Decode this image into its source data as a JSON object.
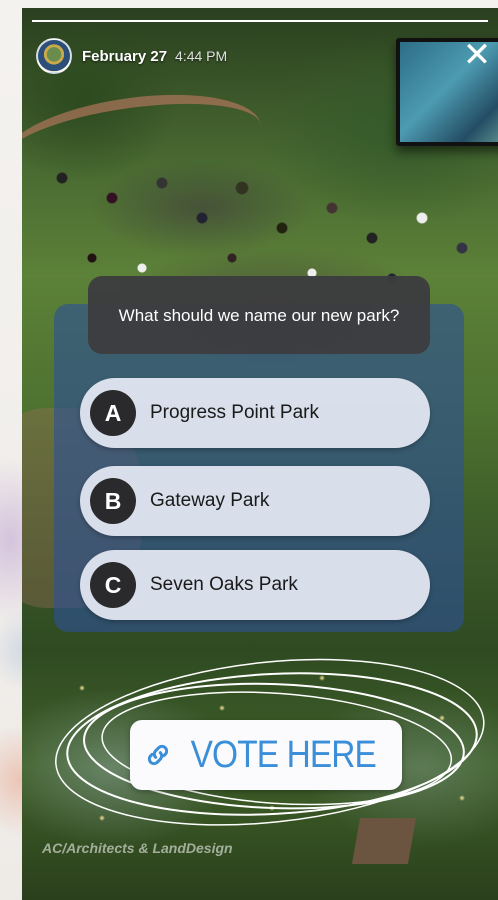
{
  "story": {
    "date": "February 27",
    "time": "4:44 PM",
    "progress": 1.0
  },
  "poll": {
    "question": "What should we name our new park?",
    "options": [
      {
        "letter": "A",
        "label": "Progress Point Park"
      },
      {
        "letter": "B",
        "label": "Gateway Park"
      },
      {
        "letter": "C",
        "label": "Seven Oaks Park"
      }
    ]
  },
  "link_sticker": {
    "label": "VOTE HERE",
    "icon": "link-icon",
    "color": "#3b8ed8"
  },
  "image_credit": "AC/Architects & LandDesign",
  "icons": {
    "close": "close-icon",
    "avatar": "avatar"
  }
}
